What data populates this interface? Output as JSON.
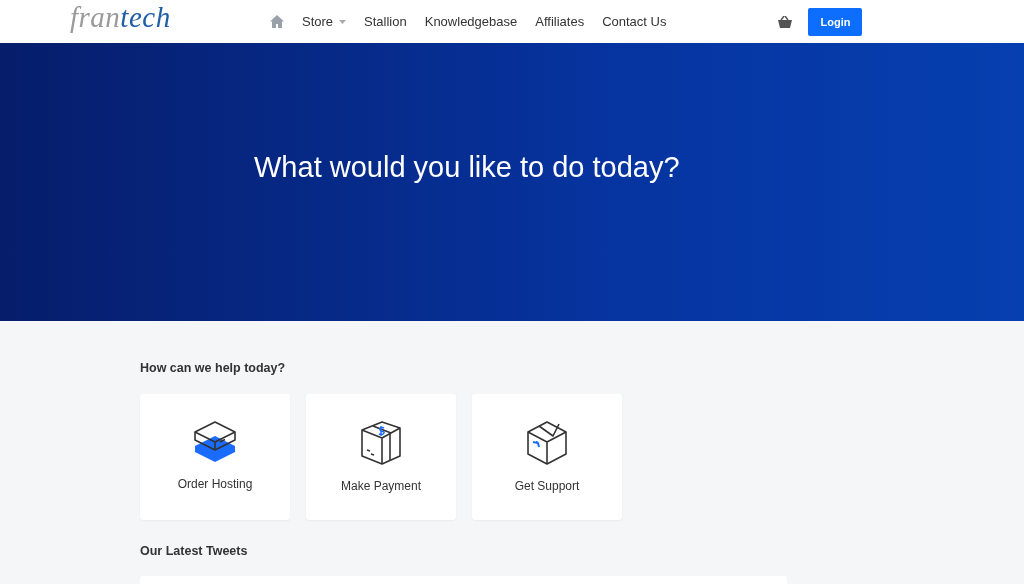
{
  "logo": [
    {
      "text": "fran",
      "color": "#9a9a9a"
    },
    {
      "text": "tech",
      "color": "#1f5fa8"
    }
  ],
  "nav": [
    {
      "label": "Store",
      "dropdown": true
    },
    {
      "label": "Stallion",
      "dropdown": false
    },
    {
      "label": "Knowledgebase",
      "dropdown": false
    },
    {
      "label": "Affiliates",
      "dropdown": false
    },
    {
      "label": "Contact Us",
      "dropdown": false
    }
  ],
  "login_button": "Login",
  "hero": {
    "title": "What would you like to do today?"
  },
  "help": {
    "heading": "How can we help today?",
    "cards": [
      {
        "kind": "hosting",
        "label": "Order Hosting"
      },
      {
        "kind": "payment",
        "label": "Make Payment"
      },
      {
        "kind": "support",
        "label": "Get Support"
      }
    ]
  },
  "tweets": {
    "heading": "Our Latest Tweets"
  }
}
